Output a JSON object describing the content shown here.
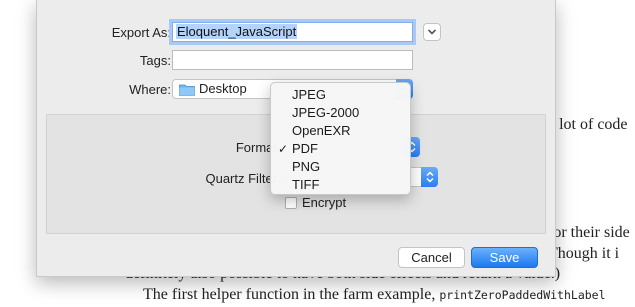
{
  "document": {
    "line1_tail": "a lot of code",
    "line2_tail": "for their side",
    "line3_tail": "Though it i",
    "line4": "definitely also possible to have both side effects and return a value.)",
    "line5_prefix": "The first helper function in the farm example,",
    "line5_code": "printZeroPaddedWithLabel"
  },
  "dialog": {
    "export_as_label": "Export As:",
    "export_as_value": "Eloquent_JavaScript",
    "tags_label": "Tags:",
    "tags_value": "",
    "where_label": "Where:",
    "where_value": "Desktop",
    "format_label": "Format",
    "quartz_filter_label": "Quartz Filter",
    "encrypt_label": "Encrypt",
    "encrypt_checked": false,
    "cancel_label": "Cancel",
    "save_label": "Save"
  },
  "format_menu": {
    "items": [
      "JPEG",
      "JPEG-2000",
      "OpenEXR",
      "PDF",
      "PNG",
      "TIFF"
    ],
    "selected": "PDF",
    "check_glyph": "✓"
  },
  "colors": {
    "accent": "#2a7ef1",
    "selection": "#b3d3fb"
  }
}
